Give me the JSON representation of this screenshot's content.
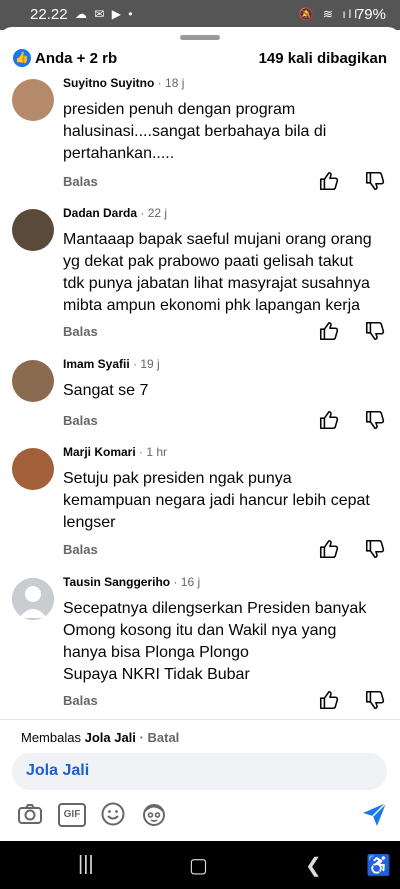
{
  "status_bar": {
    "time": "22.22",
    "battery": "79%"
  },
  "header": {
    "reactions": "Anda + 2 rb",
    "shares": "149 kali dibagikan"
  },
  "comments": [
    {
      "name": "Suyitno Suyitno",
      "time": "18 j",
      "lines": [
        "presiden penuh dengan program",
        "halusinasi....sangat berbahaya bila di",
        "pertahankan....."
      ],
      "reply": "Balas"
    },
    {
      "name": "Dadan Darda",
      "time": "22 j",
      "lines": [
        "Mantaaap bapak saeful mujani orang orang",
        "yg dekat pak prabowo paati gelisah takut",
        "tdk punya jabatan lihat masyrajat susahnya",
        "mibta ampun ekonomi phk lapangan kerja"
      ],
      "reply": "Balas"
    },
    {
      "name": "Imam Syafii",
      "time": "19 j",
      "lines": [
        "Sangat se 7"
      ],
      "reply": "Balas"
    },
    {
      "name": "Marji Komari",
      "time": "1 hr",
      "lines": [
        "Setuju pak presiden ngak punya",
        "kemampuan negara jadi hancur lebih cepat",
        "lengser"
      ],
      "reply": "Balas"
    },
    {
      "name": "Tausin Sanggeriho",
      "time": "16 j",
      "lines": [
        "Secepatnya dilengserkan Presiden banyak",
        "Omong kosong itu dan Wakil nya yang",
        "hanya bisa Plonga Plongo",
        "Supaya NKRI Tidak Bubar"
      ],
      "reply": "Balas"
    }
  ],
  "reply_bar": {
    "prefix": "Membalas",
    "target": "Jola Jali",
    "separator": "·",
    "cancel": "Batal",
    "input_value": "Jola Jali"
  },
  "toolbar": {
    "gif": "GIF",
    "icons": [
      "camera-icon",
      "gif-icon",
      "emoji-icon",
      "avatar-sticker-icon",
      "send-icon"
    ]
  },
  "colors": {
    "accent": "#1877f2",
    "mention": "#1b5fd1",
    "secondary_text": "#65676b"
  }
}
